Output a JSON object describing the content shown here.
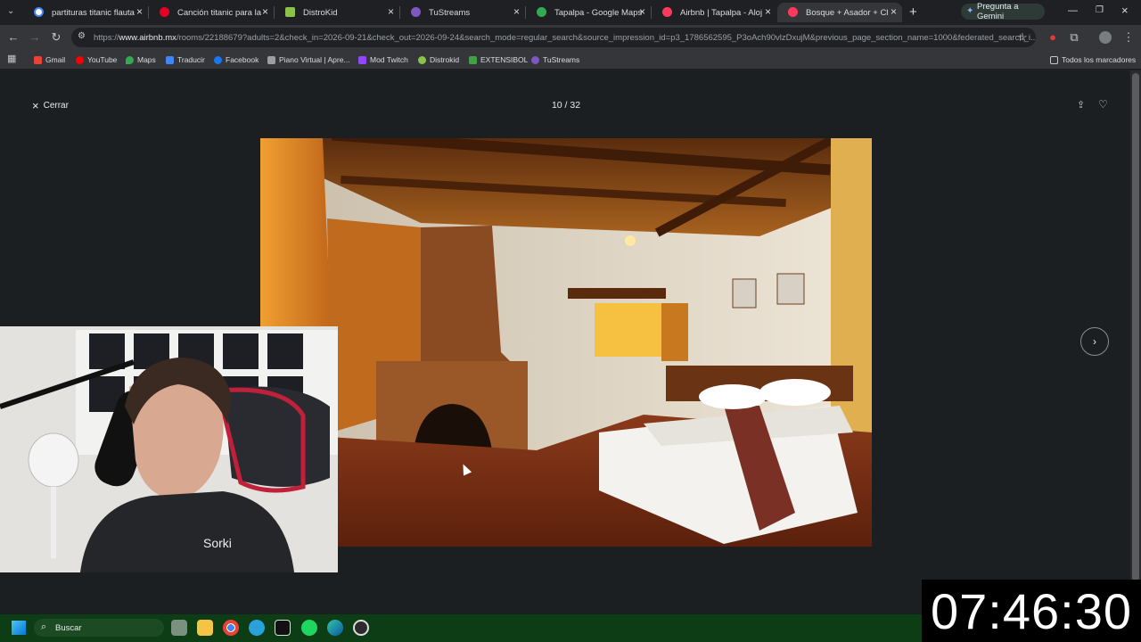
{
  "browser": {
    "tabs": [
      {
        "title": "partituras titanic flauta dulce",
        "icon": "google-icon",
        "color": "#4285f4"
      },
      {
        "title": "Canción titanic para la flauta",
        "icon": "pinterest-icon",
        "color": "#e60023"
      },
      {
        "title": "DistroKid",
        "icon": "distrokid-icon",
        "color": "#8bc34a"
      },
      {
        "title": "TuStreams",
        "icon": "tustreams-icon",
        "color": "#7e57c2"
      },
      {
        "title": "Tapalpa - Google Maps",
        "icon": "maps-icon",
        "color": "#34a853"
      },
      {
        "title": "Airbnb | Tapalpa - Alojamientos",
        "icon": "airbnb-icon",
        "color": "#ff385c"
      },
      {
        "title": "Bosque + Asador + Chimenea",
        "icon": "airbnb-icon",
        "color": "#ff385c",
        "active": true
      }
    ],
    "gemini_label": "Pregunta a Gemini",
    "url_prefix": "https://",
    "url_host": "www.airbnb.mx",
    "url_rest": "/rooms/22188679?adults=2&check_in=2026-09-21&check_out=2026-09-24&search_mode=regular_search&source_impression_id=p3_1786562595_P3oAch90vlzDxujM&previous_page_section_name=1000&federated_search_i...",
    "bookmarks": [
      {
        "label": "Gmail",
        "color": "#ea4335"
      },
      {
        "label": "YouTube",
        "color": "#ff0000"
      },
      {
        "label": "Maps",
        "color": "#34a853"
      },
      {
        "label": "Traducir",
        "color": "#4285f4"
      },
      {
        "label": "Facebook",
        "color": "#1877f2"
      },
      {
        "label": "Piano Virtual | Apre...",
        "color": "#9e9e9e"
      },
      {
        "label": "Mod Twitch",
        "color": "#9146ff"
      },
      {
        "label": "Distrokid",
        "color": "#8bc34a"
      },
      {
        "label": "EXTENSIBOL",
        "color": "#43a047"
      },
      {
        "label": "TuStreams",
        "color": "#7e57c2"
      }
    ],
    "all_bookmarks_label": "Todos los marcadores"
  },
  "gallery": {
    "close_label": "Cerrar",
    "counter": "10 / 32"
  },
  "taskbar": {
    "search_placeholder": "Buscar",
    "clock": "07:46:30"
  }
}
